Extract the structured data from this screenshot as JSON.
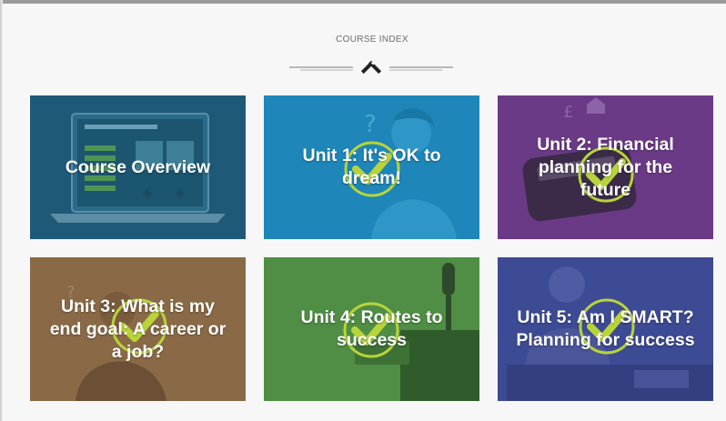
{
  "header": {
    "title": "COURSE INDEX",
    "divider_icon": "pencil-ruler-icon"
  },
  "cards": [
    {
      "title": "Course Overview",
      "completed": false,
      "color": "#1e5a78",
      "art_icon": "laptop-icon"
    },
    {
      "title": "Unit 1: It's OK to\ndream!",
      "completed": true,
      "color": "#1e86b8",
      "art_icon": "person-thinking-icon"
    },
    {
      "title": "Unit 2: Financial\nplanning for the\nfuture",
      "completed": true,
      "color": "#6b3a86",
      "art_icon": "calculator-icon"
    },
    {
      "title": "Unit 3: What is my\nend goal: A career or\na job?",
      "completed": true,
      "color": "#8a6a46",
      "art_icon": "person-desk-icon"
    },
    {
      "title": "Unit 4: Routes to\nsuccess",
      "completed": true,
      "color": "#4f8e44",
      "art_icon": "microphone-icon"
    },
    {
      "title": "Unit 5: Am I SMART?\nPlanning for success",
      "completed": true,
      "color": "#3d4a94",
      "art_icon": "person-smiling-icon"
    }
  ],
  "colors": {
    "checkmark": "#b8d43a",
    "page_background": "#f7f7f7",
    "header_text": "#6d6d6d"
  }
}
